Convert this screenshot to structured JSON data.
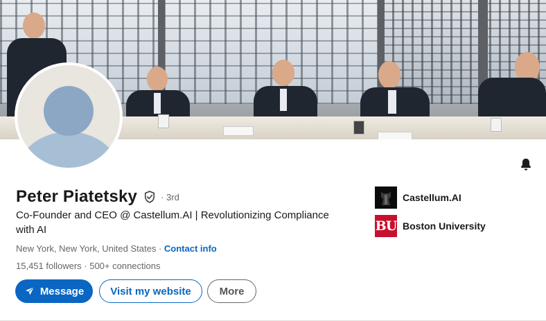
{
  "profile": {
    "name": "Peter Piatetsky",
    "degree": "· 3rd",
    "headline": "Co-Founder and CEO @ Castellum.AI | Revolutionizing Compliance with AI",
    "location": "New York, New York, United States ·",
    "contact_label": "Contact info",
    "stats": "15,451 followers · 500+ connections"
  },
  "actions": {
    "message_label": "Message",
    "website_label": "Visit my website",
    "more_label": "More"
  },
  "organizations": [
    {
      "name": "Castellum.AI",
      "logo_icon": "castellum-logo"
    },
    {
      "name": "Boston University",
      "logo_text": "BU",
      "logo_icon": "bu-logo"
    }
  ],
  "colors": {
    "brand_blue": "#0a66c2",
    "bu_red": "#c8102e"
  },
  "icons": {
    "verified": "shield-check-icon",
    "notifications": "bell-icon",
    "send": "paper-plane-icon"
  }
}
